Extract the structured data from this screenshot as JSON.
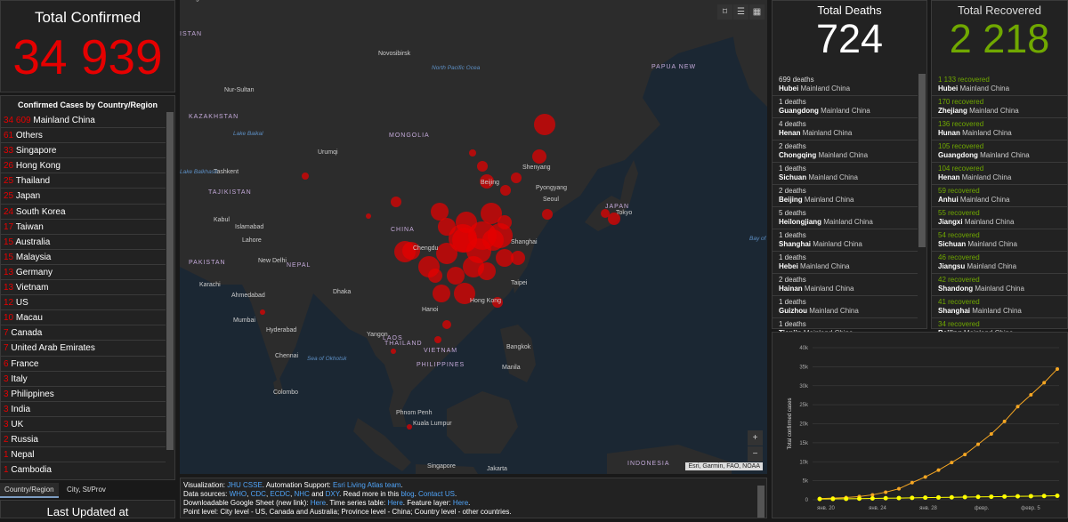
{
  "total_confirmed": {
    "title": "Total Confirmed",
    "value": "34 939"
  },
  "country_list": {
    "header": "Confirmed Cases by Country/Region",
    "items": [
      {
        "count": "34 609",
        "name": "Mainland China"
      },
      {
        "count": "61",
        "name": "Others"
      },
      {
        "count": "33",
        "name": "Singapore"
      },
      {
        "count": "26",
        "name": "Hong Kong"
      },
      {
        "count": "25",
        "name": "Thailand"
      },
      {
        "count": "25",
        "name": "Japan"
      },
      {
        "count": "24",
        "name": "South Korea"
      },
      {
        "count": "17",
        "name": "Taiwan"
      },
      {
        "count": "15",
        "name": "Australia"
      },
      {
        "count": "15",
        "name": "Malaysia"
      },
      {
        "count": "13",
        "name": "Germany"
      },
      {
        "count": "13",
        "name": "Vietnam"
      },
      {
        "count": "12",
        "name": "US"
      },
      {
        "count": "10",
        "name": "Macau"
      },
      {
        "count": "7",
        "name": "Canada"
      },
      {
        "count": "7",
        "name": "United Arab Emirates"
      },
      {
        "count": "6",
        "name": "France"
      },
      {
        "count": "3",
        "name": "Italy"
      },
      {
        "count": "3",
        "name": "Philippines"
      },
      {
        "count": "3",
        "name": "India"
      },
      {
        "count": "3",
        "name": "UK"
      },
      {
        "count": "2",
        "name": "Russia"
      },
      {
        "count": "1",
        "name": "Nepal"
      },
      {
        "count": "1",
        "name": "Cambodia"
      }
    ]
  },
  "tabs": [
    {
      "label": "Country/Region"
    },
    {
      "label": "City, St/Prov"
    }
  ],
  "last_updated": "Last Updated at",
  "map": {
    "labels": [
      {
        "t": "Novosibirsk",
        "c": "city"
      },
      {
        "t": "Nur-Sultan",
        "c": "city"
      },
      {
        "t": "KAZAKHSTAN",
        "c": "country"
      },
      {
        "t": "MONGOLIA",
        "c": "country"
      },
      {
        "t": "Urumqi",
        "c": "city"
      },
      {
        "t": "Tashkent",
        "c": "city"
      },
      {
        "t": "TAJIKISTAN",
        "c": "country"
      },
      {
        "t": "Kabul",
        "c": "city"
      },
      {
        "t": "Islamabad",
        "c": "city"
      },
      {
        "t": "Lahore",
        "c": "city"
      },
      {
        "t": "PAKISTAN",
        "c": "country"
      },
      {
        "t": "New Delhi",
        "c": "city"
      },
      {
        "t": "NEPAL",
        "c": "country"
      },
      {
        "t": "Karachi",
        "c": "city"
      },
      {
        "t": "Ahmedabad",
        "c": "city"
      },
      {
        "t": "Dhaka",
        "c": "city"
      },
      {
        "t": "Mumbai",
        "c": "city"
      },
      {
        "t": "Hyderabad",
        "c": "city"
      },
      {
        "t": "Chennai",
        "c": "city"
      },
      {
        "t": "Colombo",
        "c": "city"
      },
      {
        "t": "CHINA",
        "c": "country"
      },
      {
        "t": "Beijing",
        "c": "city"
      },
      {
        "t": "Shenyang",
        "c": "city"
      },
      {
        "t": "Pyongyang",
        "c": "city"
      },
      {
        "t": "Seoul",
        "c": "city"
      },
      {
        "t": "JAPAN",
        "c": "country"
      },
      {
        "t": "Tokyo",
        "c": "city"
      },
      {
        "t": "Shanghai",
        "c": "city"
      },
      {
        "t": "Chengdu",
        "c": "city"
      },
      {
        "t": "Taipei",
        "c": "city"
      },
      {
        "t": "Hong Kong",
        "c": "city"
      },
      {
        "t": "Hanoi",
        "c": "city"
      },
      {
        "t": "LAOS",
        "c": "country"
      },
      {
        "t": "Yangon",
        "c": "city"
      },
      {
        "t": "THAILAND",
        "c": "country"
      },
      {
        "t": "VIETNAM",
        "c": "country"
      },
      {
        "t": "Bangkok",
        "c": "city"
      },
      {
        "t": "Manila",
        "c": "city"
      },
      {
        "t": "PHILIPPINES",
        "c": "country"
      },
      {
        "t": "Phnom Penh",
        "c": "city"
      },
      {
        "t": "Kuala Lumpur",
        "c": "city"
      },
      {
        "t": "Singapore",
        "c": "city"
      },
      {
        "t": "Jakarta",
        "c": "city"
      },
      {
        "t": "INDONESIA",
        "c": "country"
      },
      {
        "t": "PAPUA NEW",
        "c": "country"
      },
      {
        "t": "Sea of Okhotsk",
        "c": "water"
      },
      {
        "t": "Bay of Bengal",
        "c": "water"
      },
      {
        "t": "North Pacific Ocea",
        "c": "water"
      },
      {
        "t": "Lake Baikal",
        "c": "water"
      },
      {
        "t": "Lake Balkhash",
        "c": "water"
      },
      {
        "t": "ISTAN",
        "c": "country"
      },
      {
        "t": "anburg",
        "c": "city"
      }
    ],
    "attribution": "Esri, Garmin, FAO, NOAA",
    "zoom_in": "+",
    "zoom_out": "−"
  },
  "info": {
    "line1_prefix": "Visualization: ",
    "line1_link1": "JHU CSSE",
    "line1_mid": ". Automation Support: ",
    "line1_link2": "Esri Living Atlas team",
    "line1_end": ".",
    "line2_prefix": "Data sources: ",
    "line2_links": [
      "WHO",
      "CDC",
      "ECDC",
      "NHC",
      "DXY"
    ],
    "line2_mid": ". Read more in this ",
    "line2_blog": "blog",
    "line2_contact": "Contact US",
    "line3_prefix": "Downloadable Google Sheet (new link): ",
    "line3_here1": "Here",
    "line3_mid": ". Time series table: ",
    "line3_here2": "Here",
    "line3_mid2": ". Feature layer: ",
    "line3_here3": "Here",
    "line4": "Point level: City level - US, Canada and Australia; Province level - China; Country level - other countries."
  },
  "total_deaths": {
    "title": "Total Deaths",
    "value": "724",
    "items": [
      {
        "count": "699 deaths",
        "region": "Hubei",
        "country": "Mainland China"
      },
      {
        "count": "1 deaths",
        "region": "Guangdong",
        "country": "Mainland China"
      },
      {
        "count": "4 deaths",
        "region": "Henan",
        "country": "Mainland China"
      },
      {
        "count": "2 deaths",
        "region": "Chongqing",
        "country": "Mainland China"
      },
      {
        "count": "1 deaths",
        "region": "Sichuan",
        "country": "Mainland China"
      },
      {
        "count": "2 deaths",
        "region": "Beijing",
        "country": "Mainland China"
      },
      {
        "count": "5 deaths",
        "region": "Heilongjiang",
        "country": "Mainland China"
      },
      {
        "count": "1 deaths",
        "region": "Shanghai",
        "country": "Mainland China"
      },
      {
        "count": "1 deaths",
        "region": "Hebei",
        "country": "Mainland China"
      },
      {
        "count": "2 deaths",
        "region": "Hainan",
        "country": "Mainland China"
      },
      {
        "count": "1 deaths",
        "region": "Guizhou",
        "country": "Mainland China"
      },
      {
        "count": "1 deaths",
        "region": "Tianjin",
        "country": "Mainland China"
      }
    ]
  },
  "total_recovered": {
    "title": "Total Recovered",
    "value": "2 218",
    "items": [
      {
        "count": "1 133 recovered",
        "region": "Hubei",
        "country": "Mainland China"
      },
      {
        "count": "170 recovered",
        "region": "Zhejiang",
        "country": "Mainland China"
      },
      {
        "count": "136 recovered",
        "region": "Hunan",
        "country": "Mainland China"
      },
      {
        "count": "105 recovered",
        "region": "Guangdong",
        "country": "Mainland China"
      },
      {
        "count": "104 recovered",
        "region": "Henan",
        "country": "Mainland China"
      },
      {
        "count": "59 recovered",
        "region": "Anhui",
        "country": "Mainland China"
      },
      {
        "count": "55 recovered",
        "region": "Jiangxi",
        "country": "Mainland China"
      },
      {
        "count": "54 recovered",
        "region": "Sichuan",
        "country": "Mainland China"
      },
      {
        "count": "46 recovered",
        "region": "Jiangsu",
        "country": "Mainland China"
      },
      {
        "count": "42 recovered",
        "region": "Shandong",
        "country": "Mainland China"
      },
      {
        "count": "41 recovered",
        "region": "Shanghai",
        "country": "Mainland China"
      },
      {
        "count": "34 recovered",
        "region": "Beijing",
        "country": "Mainland China"
      }
    ]
  },
  "colors": {
    "confirmed": "#e60000",
    "recovered": "#70a800",
    "chart_line": "#f5a623",
    "chart_line2": "#ffff00"
  },
  "chart_data": {
    "type": "line",
    "ylabel": "Total confirmed cases",
    "xlabel": "",
    "ylim": [
      0,
      40000
    ],
    "yticks": [
      "0",
      "5k",
      "10k",
      "15k",
      "20k",
      "25k",
      "30k",
      "35k",
      "40k"
    ],
    "xticks": [
      "янв. 20",
      "янв. 24",
      "янв. 28",
      "февр.",
      "февр. 5"
    ],
    "series": [
      {
        "values": [
          300,
          450,
          580,
          850,
          1300,
          2000,
          2900,
          4500,
          6000,
          7800,
          9800,
          11900,
          14600,
          17300,
          20600,
          24500,
          27600,
          30800,
          34400
        ]
      },
      {
        "values": [
          200,
          220,
          250,
          300,
          350,
          400,
          450,
          500,
          550,
          600,
          650,
          700,
          750,
          800,
          850,
          900,
          950,
          1000,
          1050
        ]
      }
    ]
  }
}
